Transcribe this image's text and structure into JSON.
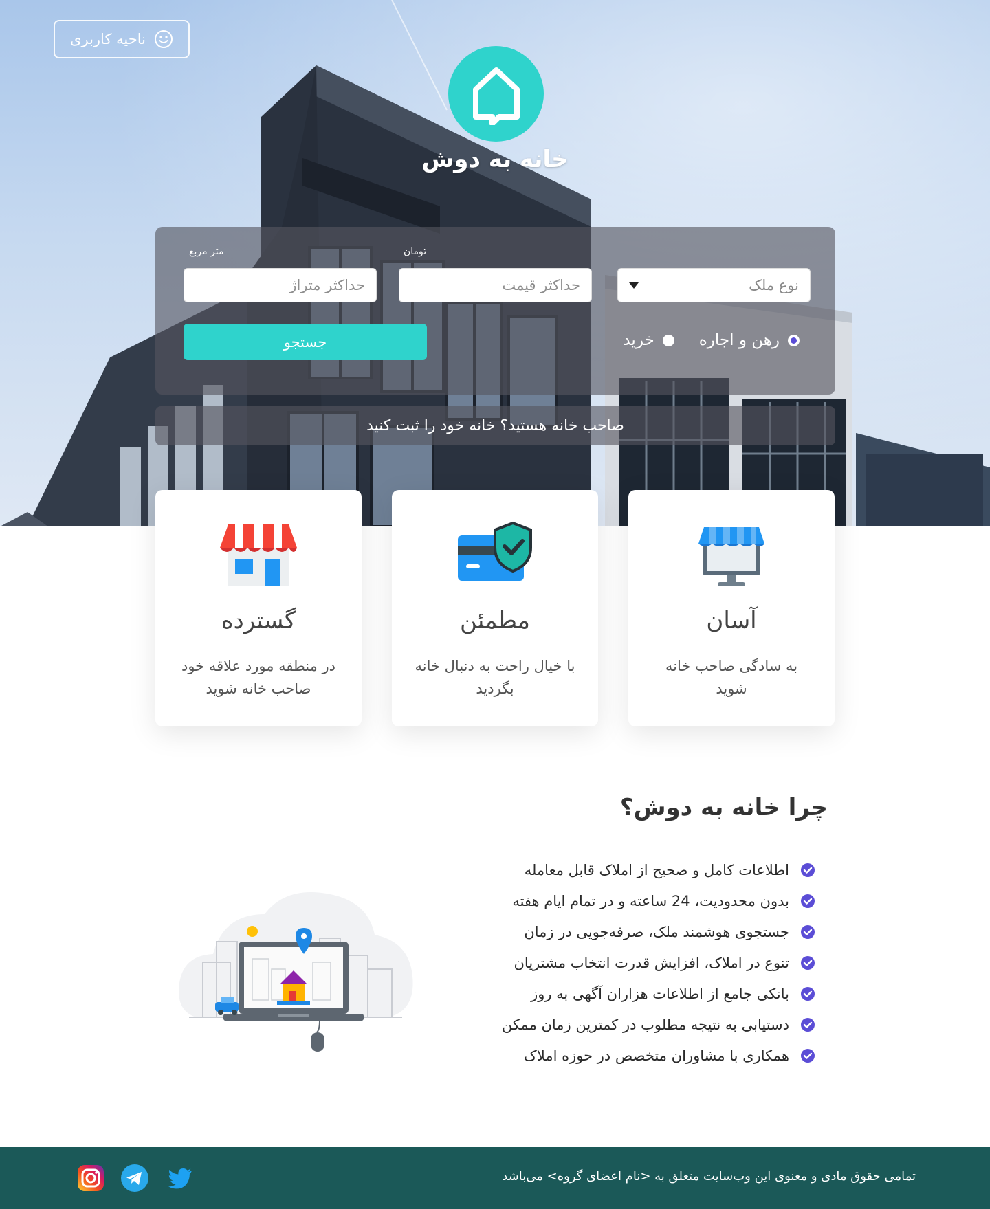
{
  "header": {
    "user_area_label": "ناحیه کاربری",
    "user_icon": "smile-icon",
    "logo_icon": "house-icon",
    "brand_name": "خانه به دوش"
  },
  "search": {
    "property_type_placeholder": "نوع ملک",
    "max_price_placeholder": "حداکثر قیمت",
    "max_price_unit": "تومان",
    "max_area_placeholder": "حداکثر متراژ",
    "max_area_unit": "متر مربع",
    "deal_types": [
      {
        "label": "رهن و اجاره",
        "checked": true
      },
      {
        "label": "خرید",
        "checked": false
      }
    ],
    "search_button": "جستجو"
  },
  "owner_cta": "صاحب خانه هستید؟ خانه خود را ثبت کنید",
  "features": [
    {
      "icon": "monitor-store-icon",
      "title": "آسان",
      "text": "به سادگی صاحب خانه شوید"
    },
    {
      "icon": "shield-card-icon",
      "title": "مطمئن",
      "text": "با خیال راحت به دنبال خانه بگردید"
    },
    {
      "icon": "store-icon",
      "title": "گسترده",
      "text": "در منطقه مورد علاقه خود صاحب خانه شوید"
    }
  ],
  "why": {
    "title": "چرا خانه به دوش؟",
    "items": [
      "اطلاعات کامل و صحیح از املاک قابل معامله",
      "بدون محدودیت، 24 ساعته و در تمام ایام هفته",
      "جستجوی هوشمند ملک، صرفه‌جویی در زمان",
      "تنوع در املاک، افزایش قدرت انتخاب مشتریان",
      "بانکی جامع از اطلاعات هزاران آگهی به روز",
      "دستیابی به نتیجه مطلوب در کمترین زمان ممکن",
      "همکاری با مشاوران متخصص در حوزه املاک"
    ],
    "illustration": "city-laptop-illustration"
  },
  "footer": {
    "copyright": "تمامی حقوق مادی و معنوی این وب‌سایت متعلق به <نام اعضای گروه> می‌باشد",
    "social": [
      "instagram-icon",
      "telegram-icon",
      "twitter-icon"
    ]
  },
  "colors": {
    "accent": "#2fd3cc",
    "footer": "#1b5958",
    "check": "#5b4dd6"
  }
}
